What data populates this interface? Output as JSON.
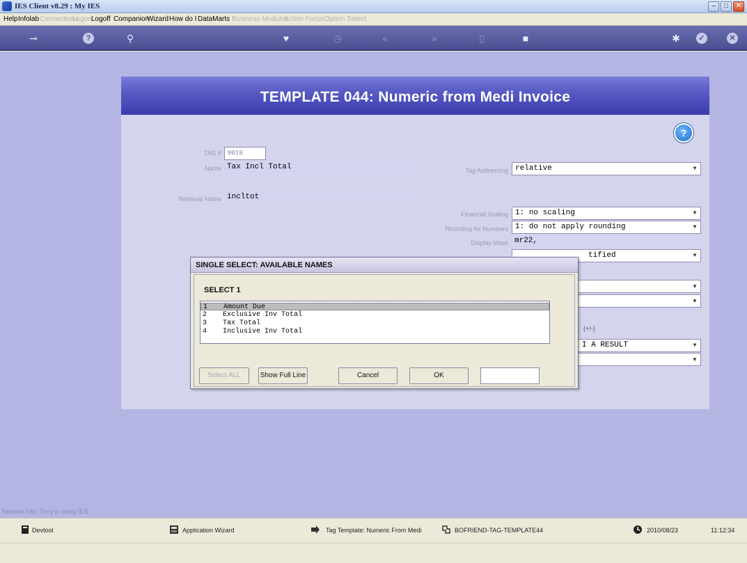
{
  "window": {
    "title": "IES Client v8.29 : My IES",
    "minimize": "–",
    "maximize": "□",
    "close": "✕"
  },
  "menu": [
    {
      "label": "Help",
      "enabled": true
    },
    {
      "label": "Infolab",
      "enabled": true
    },
    {
      "label": "Connections",
      "enabled": false
    },
    {
      "label": "Logon",
      "enabled": false
    },
    {
      "label": "Logoff",
      "enabled": true
    },
    {
      "label": "Companion",
      "enabled": true
    },
    {
      "label": "Wizard",
      "enabled": true
    },
    {
      "label": "How do I",
      "enabled": true
    },
    {
      "label": "DataMarts",
      "enabled": true
    },
    {
      "label": "Business Modules",
      "enabled": false
    },
    {
      "label": "Action Focus",
      "enabled": false
    },
    {
      "label": "Option Select",
      "enabled": false
    }
  ],
  "toolbar_icons": [
    "key-icon",
    "question-icon",
    "search-icon",
    "heart-icon",
    "clock-icon",
    "rewind-icon",
    "fast-forward-icon",
    "page-icon",
    "square-icon",
    "settings-icon",
    "check-icon",
    "close-icon"
  ],
  "page": {
    "heading": "TEMPLATE 044: Numeric from Medi Invoice",
    "help": "?",
    "tag_label": "TAG #",
    "tag_value": "0019",
    "name_label": "Name",
    "name_value": "Tax Incl Total",
    "retrieval_label": "Retrieval Name",
    "retrieval_value": "incltot",
    "tag_addressing_label": "Tag Addressing",
    "tag_addressing_value": "relative",
    "financial_scaling_label": "Financial Scaling",
    "financial_scaling_value": "1: no scaling",
    "rounding_label": "Rounding for Numbers",
    "rounding_value": "1: do not apply rounding",
    "display_mask_label": "Display Mask",
    "display_mask_value": "mr22,",
    "justify_value": "tified",
    "sign_label": "(+/-)",
    "result_value": "I A RESULT"
  },
  "dialog": {
    "title": "SINGLE SELECT: AVAILABLE NAMES",
    "instruction": "SELECT 1",
    "items": [
      {
        "num": "1",
        "text": "Amount Due"
      },
      {
        "num": "2",
        "text": "Exclusive Inv Total"
      },
      {
        "num": "3",
        "text": "Tax Total"
      },
      {
        "num": "4",
        "text": "Inclusive Inv Total"
      }
    ],
    "selected_index": 0,
    "buttons": {
      "select_all": "Select ALL",
      "show_full_line": "Show Full Line",
      "cancel": "Cancel",
      "ok": "OK"
    },
    "filter_value": ""
  },
  "session": "Session Info: Terry is using IES",
  "status": {
    "devtool": "Devtool",
    "app_wizard": "Application Wizard",
    "tag_template": "Tag Template: Numeric From Medi",
    "program": "BOFRIEND-TAG-TEMPLATE44",
    "date": "2010/08/23",
    "time": "11:12:34"
  },
  "colors": {
    "toolbar": "#4a4f93",
    "banner": "#3a3cad",
    "workspace": "#b5b5e3",
    "panel": "#d4d4ec"
  }
}
